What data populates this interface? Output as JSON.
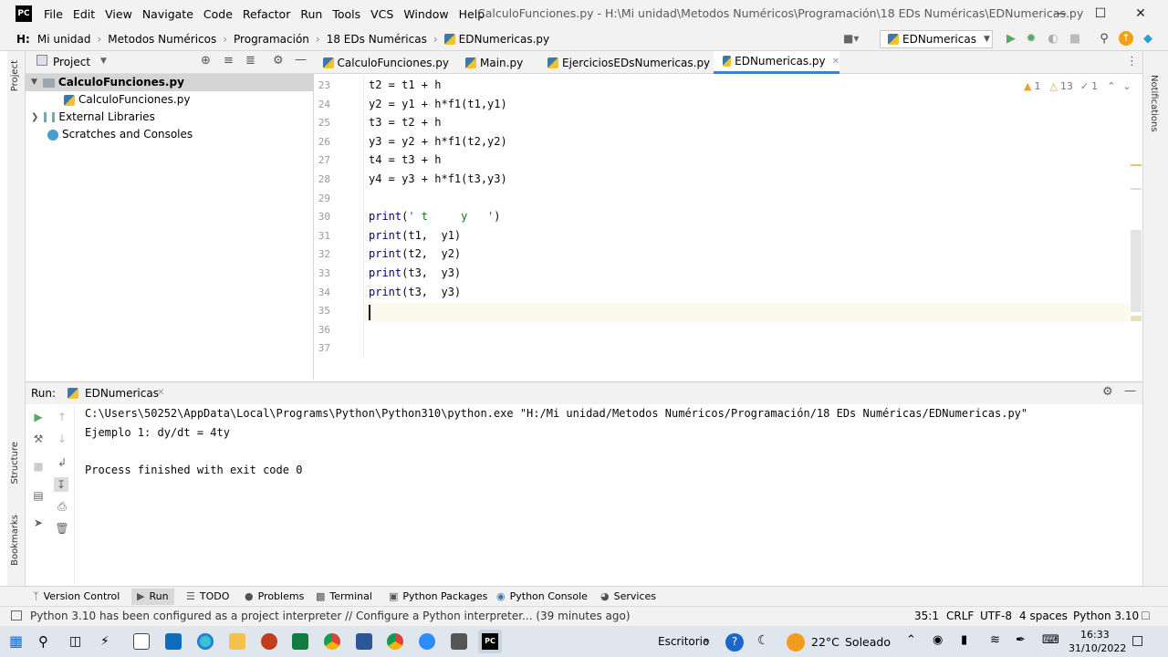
{
  "titlebar": {
    "menus": [
      "File",
      "Edit",
      "View",
      "Navigate",
      "Code",
      "Refactor",
      "Run",
      "Tools",
      "VCS",
      "Window",
      "Help"
    ],
    "window_title": "CalculoFunciones.py - H:\\Mi unidad\\Metodos Numéricos\\Programación\\18 EDs Numéricas\\EDNumericas.py",
    "minimize_icon": "minimize-icon",
    "maximize_icon": "maximize-icon",
    "close_icon": "close-icon"
  },
  "breadcrumb": {
    "drive": "H:",
    "items": [
      "Mi unidad",
      "Metodos Numéricos",
      "Programación",
      "18 EDs Numéricas",
      "EDNumericas.py"
    ]
  },
  "toolbar": {
    "run_config": "EDNumericas",
    "icons": [
      "user-icon",
      "run-icon",
      "debug-icon",
      "coverage-icon",
      "stop-icon",
      "search-icon",
      "update-icon",
      "plugin-icon"
    ]
  },
  "left_strip": {
    "project_label": "Project",
    "structure_label": "Structure",
    "bookmarks_label": "Bookmarks"
  },
  "right_strip": {
    "notifications_label": "Notifications"
  },
  "project_panel": {
    "title": "Project",
    "tree": [
      {
        "label": "CalculoFunciones.py",
        "bold": true,
        "type": "folder"
      },
      {
        "label": "CalculoFunciones.py",
        "type": "pyfile"
      },
      {
        "label": "External Libraries",
        "type": "lib"
      },
      {
        "label": "Scratches and Consoles",
        "type": "scratch"
      }
    ]
  },
  "editor": {
    "tabs": [
      "CalculoFunciones.py",
      "Main.py",
      "EjerciciosEDsNumericas.py",
      "EDNumericas.py"
    ],
    "active_tab": "EDNumericas.py",
    "inspections": {
      "warnings": "1",
      "weak_warnings": "13",
      "typos": "1"
    },
    "lines": [
      {
        "n": "23",
        "code": "t2 = t1 + h"
      },
      {
        "n": "24",
        "code": "y2 = y1 + h*f1(t1,y1)"
      },
      {
        "n": "25",
        "code": "t3 = t2 + h"
      },
      {
        "n": "26",
        "code": "y3 = y2 + h*f1(t2,y2)"
      },
      {
        "n": "27",
        "code": "t4 = t3 + h"
      },
      {
        "n": "28",
        "code": "y4 = y3 + h*f1(t3,y3)"
      },
      {
        "n": "29",
        "code": ""
      },
      {
        "n": "30",
        "code": "print(' t     y   ')"
      },
      {
        "n": "31",
        "code": "print(t1,  y1)"
      },
      {
        "n": "32",
        "code": "print(t2,  y2)"
      },
      {
        "n": "33",
        "code": "print(t3,  y3)"
      },
      {
        "n": "34",
        "code": "print(t3,  y3)"
      },
      {
        "n": "35",
        "code": ""
      },
      {
        "n": "36",
        "code": ""
      },
      {
        "n": "37",
        "code": ""
      }
    ]
  },
  "run_panel": {
    "label": "Run:",
    "tab": "EDNumericas",
    "output": [
      "C:\\Users\\50252\\AppData\\Local\\Programs\\Python\\Python310\\python.exe \"H:/Mi unidad/Metodos Numéricos/Programación/18 EDs Numéricas/EDNumericas.py\"",
      "Ejemplo 1: dy/dt = 4ty",
      "",
      "Process finished with exit code 0"
    ]
  },
  "bottom_tools": [
    "Version Control",
    "Run",
    "TODO",
    "Problems",
    "Terminal",
    "Python Packages",
    "Python Console",
    "Services"
  ],
  "status": {
    "message": "Python 3.10 has been configured as a project interpreter // Configure a Python interpreter... (39 minutes ago)",
    "position": "35:1",
    "line_sep": "CRLF",
    "encoding": "UTF-8",
    "indent": "4 spaces",
    "interpreter": "Python 3.10"
  },
  "taskbar": {
    "desktop_label": "Escritorio",
    "weather_temp": "22°C",
    "weather_text": "Soleado",
    "time": "16:33",
    "date": "31/10/2022"
  },
  "colors": {
    "accent": "#4083c9",
    "run_green": "#59a869",
    "current_line": "#fcfaed"
  }
}
